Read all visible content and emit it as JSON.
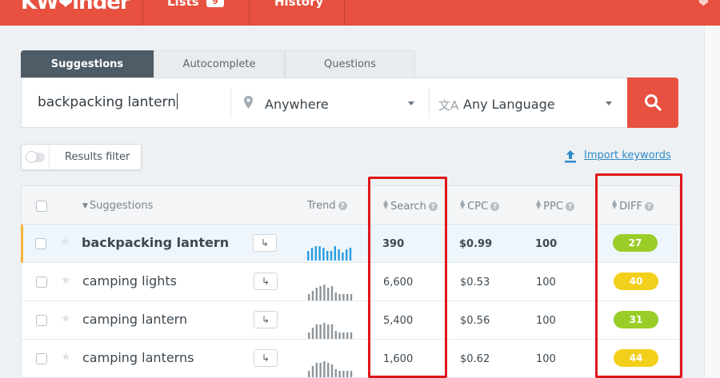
{
  "app": {
    "logo_left": "KW",
    "logo_right": "inder",
    "nav": [
      {
        "label": "Lists",
        "badge": "9"
      },
      {
        "label": "History"
      }
    ]
  },
  "tabs": [
    {
      "label": "Suggestions",
      "active": true
    },
    {
      "label": "Autocomplete",
      "active": false
    },
    {
      "label": "Questions",
      "active": false
    }
  ],
  "search": {
    "keyword": "backpacking lantern",
    "location": "Anywhere",
    "language": "Any Language"
  },
  "filter": {
    "label": "Results filter"
  },
  "import": {
    "label": "Import keywords"
  },
  "table": {
    "headers": {
      "suggestions": "Suggestions",
      "trend": "Trend",
      "search": "Search",
      "cpc": "CPC",
      "ppc": "PPC",
      "diff": "DIFF"
    },
    "rows": [
      {
        "keyword": "backpacking lantern",
        "search": "390",
        "cpc": "$0.99",
        "ppc": "100",
        "diff": "27",
        "diff_color": "#9bcd28",
        "selected": true,
        "trend": [
          0.6,
          0.8,
          0.9,
          0.9,
          0.8,
          0.6,
          0.6,
          0.9,
          0.7,
          0.5,
          0.7,
          0.8
        ]
      },
      {
        "keyword": "camping lights",
        "search": "6,600",
        "cpc": "$0.53",
        "ppc": "100",
        "diff": "40",
        "diff_color": "#f2cf1a",
        "selected": false,
        "trend": [
          0.4,
          0.6,
          0.8,
          0.9,
          1.0,
          0.8,
          0.9,
          0.5,
          0.4,
          0.4,
          0.4,
          0.4
        ]
      },
      {
        "keyword": "camping lantern",
        "search": "5,400",
        "cpc": "$0.56",
        "ppc": "100",
        "diff": "31",
        "diff_color": "#9bcd28",
        "selected": false,
        "trend": [
          0.4,
          0.7,
          0.9,
          0.9,
          1.0,
          0.9,
          0.9,
          0.5,
          0.4,
          0.4,
          0.4,
          0.4
        ]
      },
      {
        "keyword": "camping lanterns",
        "search": "1,600",
        "cpc": "$0.62",
        "ppc": "100",
        "diff": "44",
        "diff_color": "#f2cf1a",
        "selected": false,
        "trend": [
          0.4,
          0.7,
          0.9,
          0.9,
          1.0,
          0.9,
          0.8,
          0.5,
          0.4,
          0.4,
          0.4,
          0.4
        ]
      }
    ],
    "trend_colors": {
      "selected": "#2a9be0",
      "normal": "#8c959c"
    }
  }
}
